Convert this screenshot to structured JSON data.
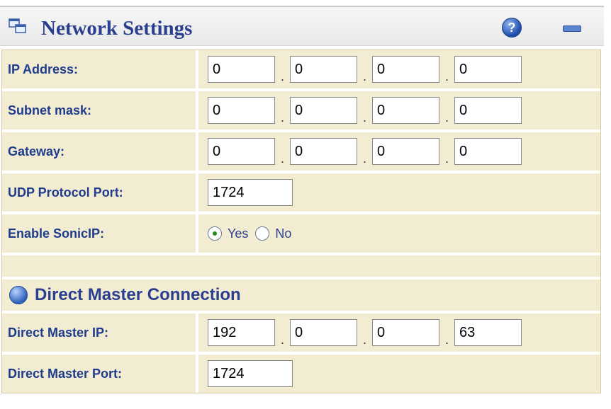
{
  "panel": {
    "title": "Network Settings",
    "help_label": "?",
    "icon": "network-window-icon"
  },
  "rows": {
    "ip_address": {
      "label": "IP Address:",
      "octets": [
        "0",
        "0",
        "0",
        "0"
      ]
    },
    "subnet_mask": {
      "label": "Subnet mask:",
      "octets": [
        "0",
        "0",
        "0",
        "0"
      ]
    },
    "gateway": {
      "label": "Gateway:",
      "octets": [
        "0",
        "0",
        "0",
        "0"
      ]
    },
    "udp_port": {
      "label": "UDP Protocol Port:",
      "value": "1724"
    },
    "sonic_ip": {
      "label": "Enable SonicIP:",
      "options": [
        "Yes",
        "No"
      ],
      "selected": "Yes"
    }
  },
  "section": {
    "title": "Direct Master Connection",
    "icon": "globe-icon"
  },
  "direct_master": {
    "ip": {
      "label": "Direct Master IP:",
      "octets": [
        "192",
        "0",
        "0",
        "63"
      ]
    },
    "port": {
      "label": "Direct Master Port:",
      "value": "1724"
    }
  },
  "separator": ".",
  "colors": {
    "label_text": "#1f3c8c",
    "row_bg": "#f2ecd2",
    "title_text": "#2b3f8f"
  }
}
